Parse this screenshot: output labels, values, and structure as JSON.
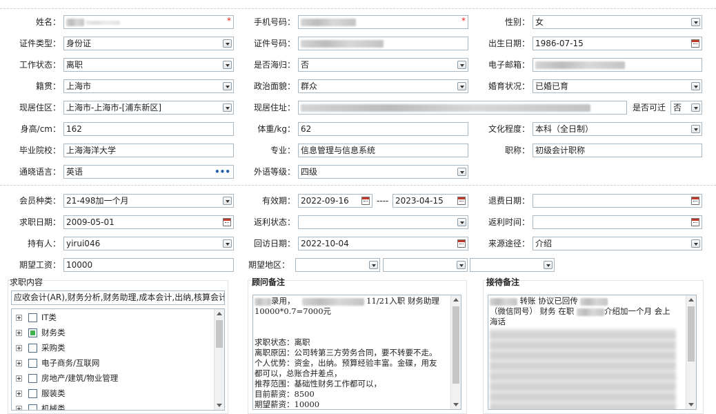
{
  "form": {
    "name": {
      "label": "姓名：",
      "value": ""
    },
    "mobile": {
      "label": "手机号码：",
      "value": ""
    },
    "gender": {
      "label": "性别：",
      "value": "女"
    },
    "id_type": {
      "label": "证件类型：",
      "value": "身份证"
    },
    "id_no": {
      "label": "证件号码：",
      "value": ""
    },
    "birth": {
      "label": "出生日期：",
      "value": "1986-07-15"
    },
    "work_status": {
      "label": "工作状态：",
      "value": "离职"
    },
    "overseas": {
      "label": "是否海归：",
      "value": "否"
    },
    "email": {
      "label": "电子邮箱：",
      "value": ""
    },
    "native": {
      "label": "籍贯：",
      "value": "上海市"
    },
    "political": {
      "label": "政治面貌：",
      "value": "群众"
    },
    "marital": {
      "label": "婚育状况：",
      "value": "已婚已育"
    },
    "residence_area": {
      "label": "现居住区：",
      "value": "上海市-上海市-[浦东新区]"
    },
    "address": {
      "label": "现居住址：",
      "value": ""
    },
    "relocate": {
      "label": "是否可迁",
      "value": "否"
    },
    "height": {
      "label": "身高/cm：",
      "value": "162"
    },
    "weight": {
      "label": "体重/kg：",
      "value": "62"
    },
    "education": {
      "label": "文化程度：",
      "value": "本科（全日制）"
    },
    "school": {
      "label": "毕业院校：",
      "value": "上海海洋大学"
    },
    "major": {
      "label": "专业：",
      "value": "信息管理与信息系统"
    },
    "title": {
      "label": "职称：",
      "value": "初级会计职称"
    },
    "language": {
      "label": "通晓语言：",
      "value": "英语"
    },
    "lang_level": {
      "label": "外语等级：",
      "value": "四级"
    },
    "member_type": {
      "label": "会员种类：",
      "value": "21-498加一个月"
    },
    "valid": {
      "label": "有效期：",
      "from": "2022-09-16",
      "sep": "----",
      "to": "2023-04-15"
    },
    "refund_date": {
      "label": "退费日期：",
      "value": ""
    },
    "job_date": {
      "label": "求职日期：",
      "value": "2009-05-01"
    },
    "rebate_status": {
      "label": "返利状态：",
      "value": ""
    },
    "rebate_time": {
      "label": "返利时间：",
      "value": ""
    },
    "holder": {
      "label": "持有人：",
      "value": "yirui046"
    },
    "visit_date": {
      "label": "回访日期：",
      "value": "2022-10-04"
    },
    "source": {
      "label": "来源途径：",
      "value": "介绍"
    },
    "salary": {
      "label": "期望工资：",
      "value": "10000"
    },
    "region": {
      "label": "期望地区：",
      "value": ""
    }
  },
  "job_panel": {
    "title": "求职内容",
    "summary": "应收会计(AR),财务分析,财务助理,成本会计,出纳,核算会计",
    "categories": [
      {
        "label": "IT类",
        "checked": false
      },
      {
        "label": "财务类",
        "checked": true
      },
      {
        "label": "采购类",
        "checked": false
      },
      {
        "label": "电子商务/互联网",
        "checked": false
      },
      {
        "label": "房地产/建筑/物业管理",
        "checked": false
      },
      {
        "label": "服装类",
        "checked": false
      },
      {
        "label": "机械类",
        "checked": false
      }
    ]
  },
  "advisor_panel": {
    "title": "顾问备注",
    "line1_a": "录用，",
    "line1_b": "11/21入职 财务助理",
    "lines": [
      "10000*0.7=7000元",
      "",
      "",
      "求职状态：离职",
      "离职原因：公司转第三方劳务合同，要不转要不走。",
      "个人优势：资金，出纳。预算经验丰富。金碟，用友",
      "都可以，总账合并差点，",
      "推荐范围：基础性财务工作都可以，",
      "目前薪资：8500",
      "期望薪资：10000"
    ]
  },
  "reception_panel": {
    "title": "接待备注",
    "line1": "转账 协议已回传",
    "line2_a": "（微信同号） 财务 在职",
    "line2_b": "介绍加一个月 会上",
    "line3": "海话"
  }
}
